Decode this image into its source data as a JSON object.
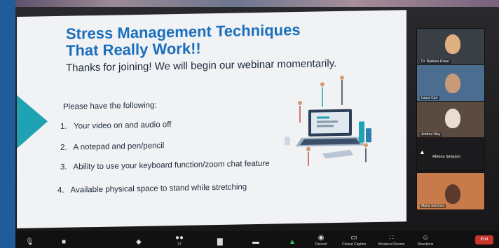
{
  "slide": {
    "title_line1": "Stress Management Techniques",
    "title_line2": "That Really Work!!",
    "subtitle": "Thanks for joining! We will begin our webinar momentarily.",
    "have_heading": "Please have the following:",
    "items": [
      {
        "num": "1.",
        "text": "Your video on and audio off"
      },
      {
        "num": "2.",
        "text": "A notepad and pen/pencil"
      },
      {
        "num": "3.",
        "text": "Ability to use your keyboard function/zoom chat feature"
      },
      {
        "num": "4.",
        "text": "Available physical space to stand while stretching"
      }
    ],
    "accent_color": "#1fa3b4",
    "title_color": "#1b6fbc"
  },
  "participants": [
    {
      "name": "Dr. Barbara Rowe"
    },
    {
      "name": "Laura Carr"
    },
    {
      "name": "Andrea Way"
    },
    {
      "name": "Athena Simpson"
    },
    {
      "name": "Maria Sanchez"
    }
  ],
  "toolbar": {
    "items": [
      {
        "label": "",
        "icon": "microphone-icon"
      },
      {
        "label": "",
        "icon": "video-camera-icon"
      },
      {
        "label": "",
        "icon": "security-shield-icon"
      },
      {
        "label": "",
        "icon": "participants-icon"
      },
      {
        "label": "",
        "icon": "poll-chart-icon"
      },
      {
        "label": "",
        "icon": "chat-bubble-icon"
      },
      {
        "label": "",
        "icon": "share-screen-icon"
      },
      {
        "label": "Record",
        "icon": "record-icon"
      },
      {
        "label": "Closed Caption",
        "icon": "closed-caption-icon"
      },
      {
        "label": "Breakout Rooms",
        "icon": "breakout-rooms-icon"
      },
      {
        "label": "Reactions",
        "icon": "reactions-icon"
      }
    ],
    "end_label": "End",
    "participant_count": "37"
  }
}
